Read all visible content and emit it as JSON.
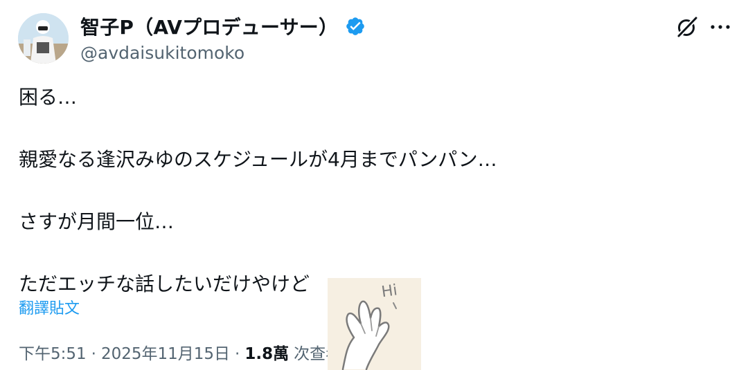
{
  "author": {
    "display_name": "智子P（AVプロデューサー）",
    "handle": "@avdaisukitomoko",
    "verified": true,
    "verified_color": "#1d9bf0"
  },
  "tweet": {
    "lines": [
      "困る…",
      "",
      "親愛なる逢沢みゆのスケジュールが4月までパンパン…",
      "",
      "さすが月間一位…",
      "",
      "ただエッチな話したいだけやけど"
    ]
  },
  "translate_label": "翻譯貼文",
  "meta": {
    "time": "下午5:51",
    "separator": "·",
    "date": "2025年11月15日",
    "views_count": "1.8萬",
    "views_label": "次查看"
  },
  "sticker": {
    "text": "Hi",
    "icon": "waving-hand-sticker"
  },
  "colors": {
    "text_primary": "#0f1419",
    "text_secondary": "#536471",
    "link": "#1d9bf0"
  }
}
